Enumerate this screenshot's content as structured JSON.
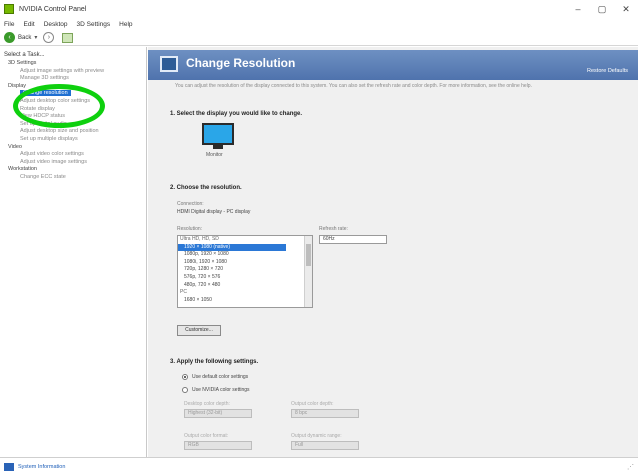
{
  "window": {
    "title": "NVIDIA Control Panel",
    "minimize": "–",
    "maximize": "▢",
    "close": "✕"
  },
  "menu": [
    "File",
    "Edit",
    "Desktop",
    "3D Settings",
    "Help"
  ],
  "toolbar": {
    "back_label": "Back",
    "dropdown": "▾",
    "forward_glyph": "›",
    "back_glyph": "‹"
  },
  "sidebar": {
    "heading": "Select a Task...",
    "items": [
      {
        "label": "3D Settings",
        "kind": "cat"
      },
      {
        "label": "Adjust image settings with preview",
        "kind": "sub"
      },
      {
        "label": "Manage 3D settings",
        "kind": "sub"
      },
      {
        "label": "Display",
        "kind": "cat"
      },
      {
        "label": "Change resolution",
        "kind": "sel"
      },
      {
        "label": "Adjust desktop color settings",
        "kind": "sub"
      },
      {
        "label": "Rotate display",
        "kind": "sub"
      },
      {
        "label": "View HDCP status",
        "kind": "sub"
      },
      {
        "label": "Set up digital audio",
        "kind": "sub"
      },
      {
        "label": "Adjust desktop size and position",
        "kind": "sub"
      },
      {
        "label": "Set up multiple displays",
        "kind": "sub"
      },
      {
        "label": "Video",
        "kind": "cat"
      },
      {
        "label": "Adjust video color settings",
        "kind": "sub"
      },
      {
        "label": "Adjust video image settings",
        "kind": "sub"
      },
      {
        "label": "Workstation",
        "kind": "cat"
      },
      {
        "label": "Change ECC state",
        "kind": "sub"
      }
    ]
  },
  "main": {
    "title": "Change Resolution",
    "restore_link": "Restore Defaults",
    "description": "You can adjust the resolution of the display connected to this system. You can also set the refresh rate and color depth. For more information, see the online help.",
    "section1": "1. Select the display you would like to change.",
    "display_name": "Monitor",
    "section2": "2. Choose the resolution.",
    "connection_label": "Connection:",
    "connection_value": "HDMI   Digital display - PC display",
    "resolution_label": "Resolution:",
    "refresh_label": "Refresh rate:",
    "refresh_value": "60Hz",
    "resolutions": [
      {
        "label": "Ultra HD, HD, SD",
        "kind": "grp"
      },
      {
        "label": "1920 × 1080 (native)",
        "kind": "sel"
      },
      {
        "label": "1080p, 1920 × 1080",
        "kind": "item"
      },
      {
        "label": "1080i, 1920 × 1080",
        "kind": "item"
      },
      {
        "label": "720p, 1280 × 720",
        "kind": "item"
      },
      {
        "label": "576p, 720 × 576",
        "kind": "item"
      },
      {
        "label": "480p, 720 × 480",
        "kind": "item"
      },
      {
        "label": "PC",
        "kind": "grp"
      },
      {
        "label": "1680 × 1050",
        "kind": "item"
      }
    ],
    "customize_button": "Customize...",
    "section3": "3. Apply the following settings.",
    "radio1": "Use default color settings",
    "radio2": "Use NVIDIA color settings",
    "desktop_depth_label": "Desktop color depth:",
    "desktop_depth_value": "Highest (32-bit)",
    "output_depth_label": "Output color depth:",
    "output_depth_value": "8 bpc",
    "output_format_label": "Output color format:",
    "output_format_value": "RGB",
    "dynamic_range_label": "Output dynamic range:",
    "dynamic_range_value": "Full"
  },
  "status": {
    "link": "System Information",
    "grip": "⋰"
  }
}
